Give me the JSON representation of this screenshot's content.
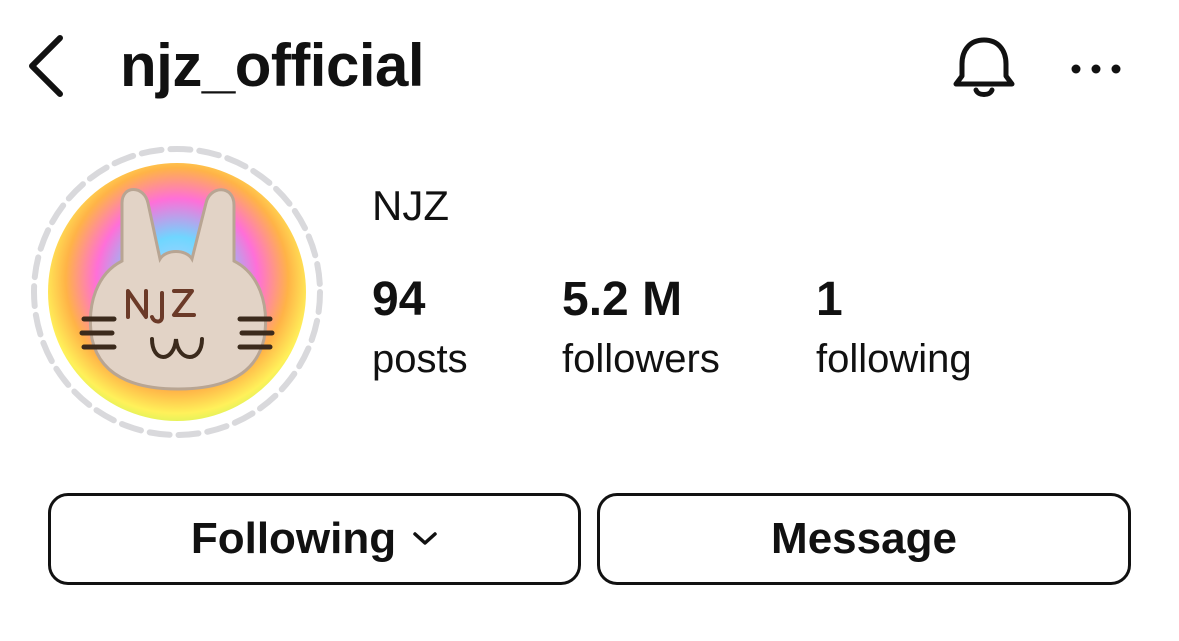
{
  "header": {
    "username": "njz_official",
    "back_icon": "chevron-left-icon",
    "notification_icon": "bell-icon",
    "more_icon": "more-horizontal-icon"
  },
  "profile": {
    "display_name": "NJZ",
    "avatar_text": "NJZ",
    "stats": {
      "posts": {
        "value": "94",
        "label": "posts"
      },
      "followers": {
        "value": "5.2 M",
        "label": "followers"
      },
      "following": {
        "value": "1",
        "label": "following"
      }
    }
  },
  "actions": {
    "following_label": "Following",
    "following_icon": "chevron-down-icon",
    "message_label": "Message"
  },
  "colors": {
    "text": "#111111",
    "background": "#ffffff",
    "story_ring_seen": "#d9d9dc",
    "avatar_bunny": "#e2d3c6"
  }
}
